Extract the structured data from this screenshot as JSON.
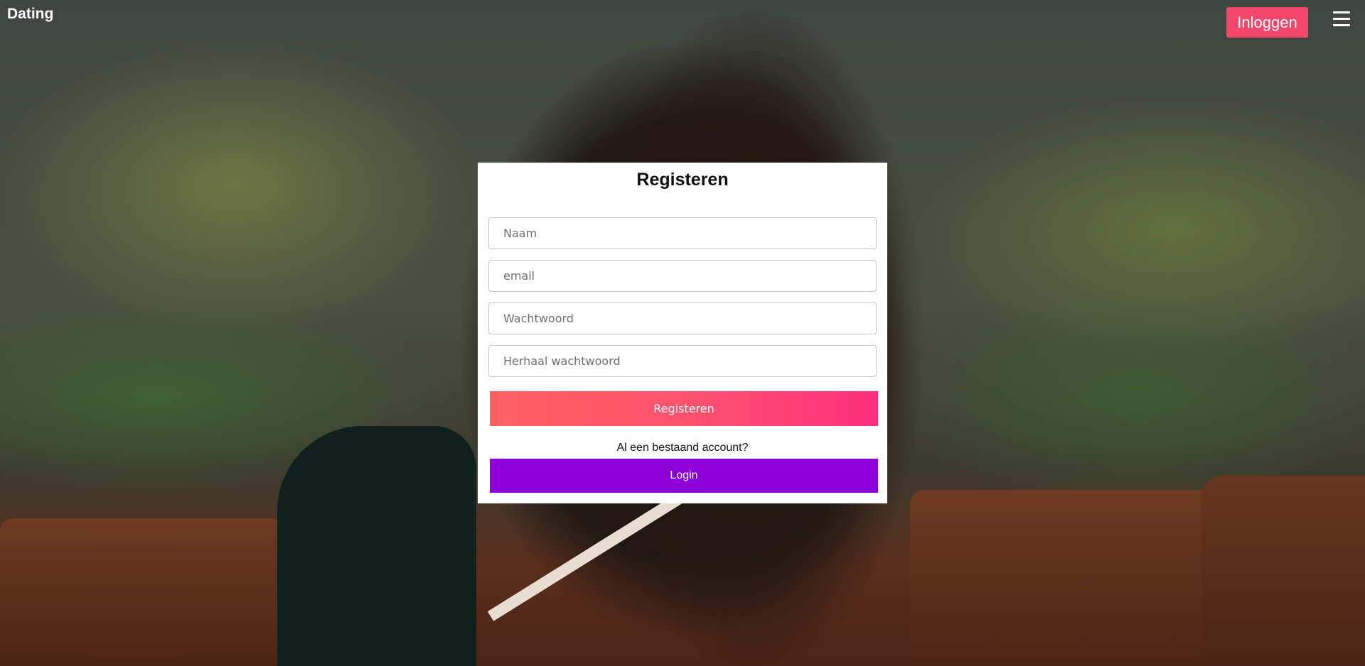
{
  "header": {
    "brand": "Dating",
    "login_button": "Inloggen",
    "menu_icon": "hamburger-menu-icon"
  },
  "register_form": {
    "title": "Registeren",
    "fields": {
      "name_placeholder": "Naam",
      "email_placeholder": "email",
      "password_placeholder": "Wachtwoord",
      "repeat_password_placeholder": "Herhaal wachtwoord"
    },
    "register_button": "Registeren",
    "existing_account_text": "Al een bestaand account?",
    "login_button": "Login"
  },
  "colors": {
    "login_top_button": "#f4466b",
    "register_gradient_start": "#fe6160",
    "register_gradient_end": "#fd2f7d",
    "login_button": "#8e00d9"
  }
}
